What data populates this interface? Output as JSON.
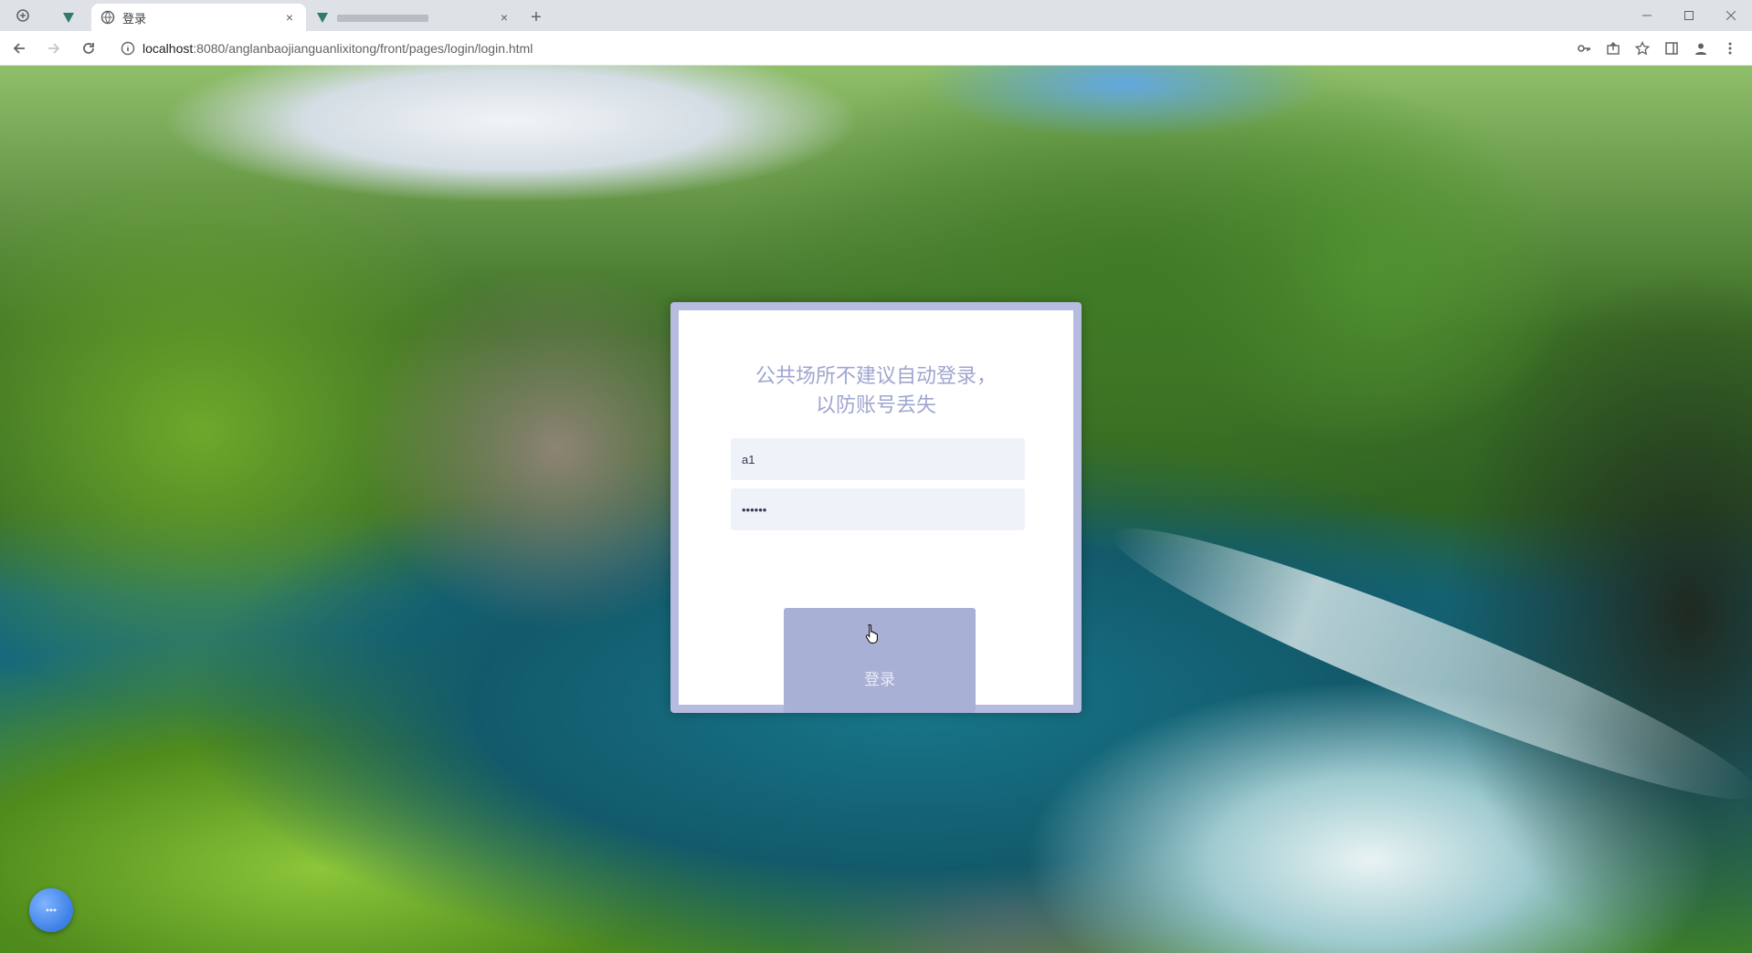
{
  "browser": {
    "tabs": [
      {
        "title": "",
        "icon": "tab-favicon",
        "active": false,
        "pinned": true
      },
      {
        "title": "登录",
        "icon": "tab-favicon",
        "active": true,
        "close": "×"
      },
      {
        "title": "",
        "icon": "tab-favicon",
        "active": false,
        "close": "×"
      }
    ],
    "new_tab": "+",
    "url_host": "localhost",
    "url_path": ":8080/anglanbaojianguanlixitong/front/pages/login/login.html"
  },
  "login": {
    "notice_line1": "公共场所不建议自动登录，",
    "notice_line2": "以防账号丢失",
    "username_value": "a1",
    "password_value": "••••••",
    "button_label": "登录"
  },
  "colors": {
    "card_border": "#b6bce0",
    "notice_text": "#9fa6cf",
    "button_bg": "#a9b0d5",
    "input_bg": "#eff2f9"
  }
}
